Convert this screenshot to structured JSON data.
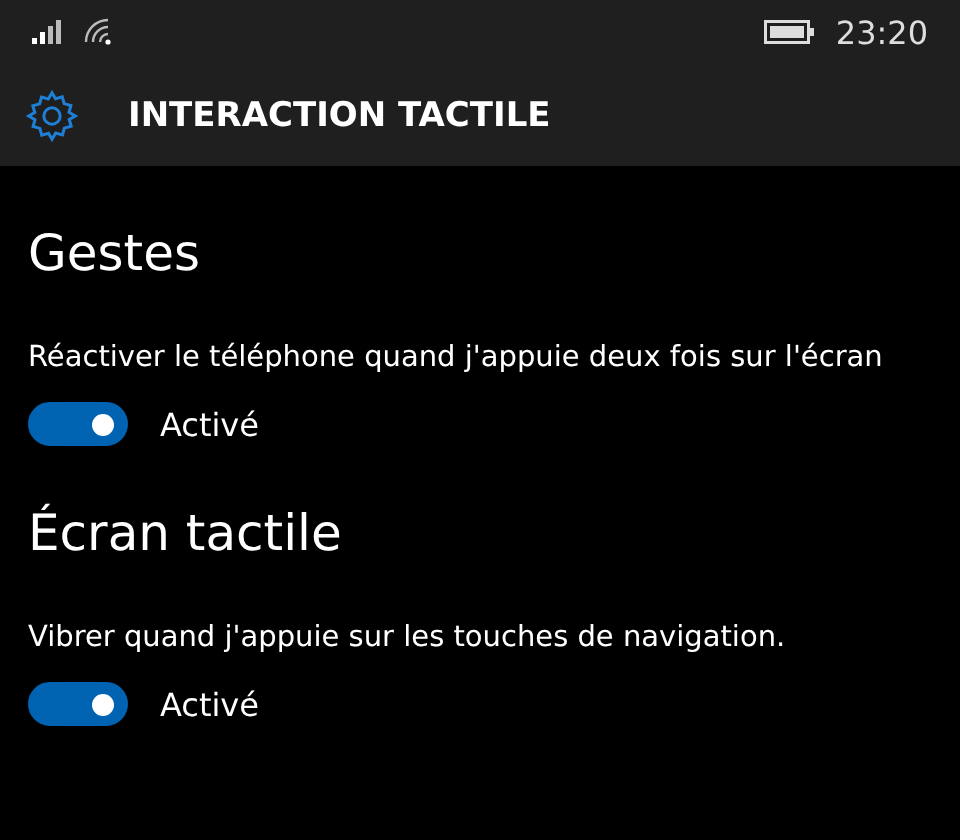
{
  "status_bar": {
    "time": "23:20"
  },
  "header": {
    "title": "INTERACTION TACTILE"
  },
  "sections": [
    {
      "title": "Gestes",
      "settings": [
        {
          "description": "Réactiver le téléphone quand j'appuie deux fois sur l'écran",
          "on": true,
          "state_label": "Activé"
        }
      ]
    },
    {
      "title": "Écran tactile",
      "settings": [
        {
          "description": "Vibrer quand j'appuie sur les touches de navigation.",
          "on": true,
          "state_label": "Activé"
        }
      ]
    }
  ]
}
